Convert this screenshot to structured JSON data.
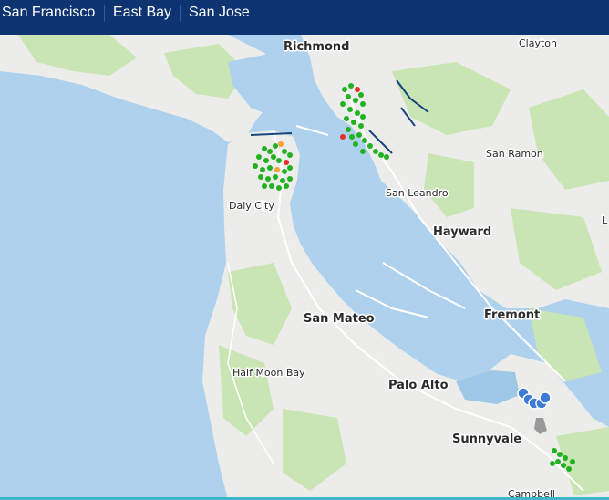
{
  "nav": {
    "tabs": [
      {
        "label": "San Francisco"
      },
      {
        "label": "East Bay"
      },
      {
        "label": "San Jose"
      }
    ]
  },
  "map": {
    "place_labels": {
      "richmond": "Richmond",
      "clayton": "Clayton",
      "san_ramon": "San Ramon",
      "san_leandro": "San Leandro",
      "daly_city": "Daly City",
      "hayward": "Hayward",
      "fremont": "Fremont",
      "san_mateo": "San Mateo",
      "half_moon_bay": "Half Moon Bay",
      "palo_alto": "Palo Alto",
      "sunnyvale": "Sunnyvale",
      "campbell": "Campbell",
      "edge_l": "L"
    },
    "colors": {
      "water": "#aed1ed",
      "land": "#ececea",
      "park": "#c9e5b4",
      "marker_green": "#21b121",
      "marker_red": "#e8302a",
      "marker_orange": "#f2a33a",
      "marker_blue": "#3f7ad9",
      "accent_bar": "#0d3370"
    }
  }
}
